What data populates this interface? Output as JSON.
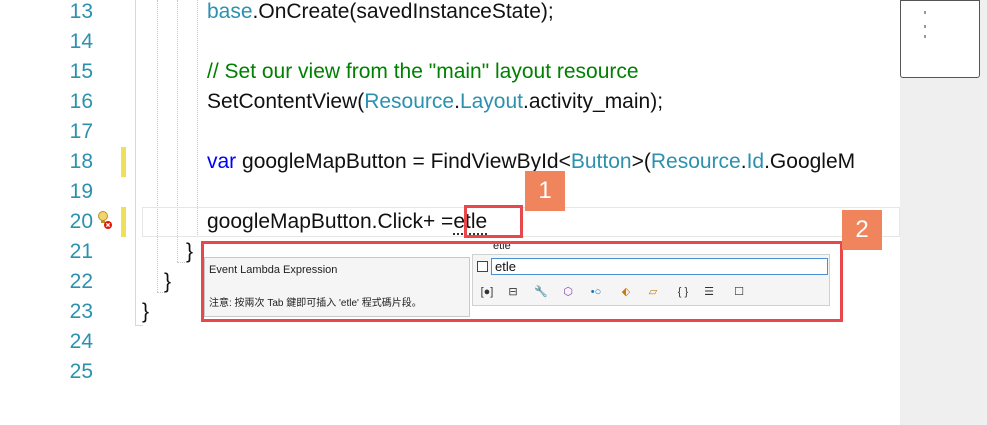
{
  "editor": {
    "line_numbers": [
      "13",
      "14",
      "15",
      "16",
      "17",
      "18",
      "19",
      "20",
      "21",
      "22",
      "23",
      "24",
      "25"
    ],
    "lines": {
      "l13": {
        "a": "base",
        "b": ".OnCreate(savedInstanceState);"
      },
      "l15": {
        "comment": "// Set our view from the \"main\" layout resource"
      },
      "l16": {
        "a": "SetContentView(",
        "b": "Resource",
        "c": ".",
        "d": "Layout",
        "e": ".activity_main);"
      },
      "l18": {
        "a": "var",
        "b": " googleMapButton = FindViewById<",
        "c": "Button",
        "d": ">(",
        "e": "Resource",
        "f": ".",
        "g": "Id",
        "h": ".GoogleM"
      },
      "l20": {
        "a": "googleMapButton.Click+ =",
        "b": "etle"
      },
      "l21": {
        "brace": "}"
      },
      "l22": {
        "brace": "}"
      },
      "l23": {
        "brace": "}"
      }
    }
  },
  "callouts": {
    "one": "1",
    "two": "2"
  },
  "completion": {
    "title": "Event Lambda Expression",
    "hint": "注意: 按兩次 Tab 鍵即可插入 'etle' 程式碼片段。",
    "snippet_label": "etle",
    "snippet_value": "etle",
    "filters": [
      {
        "name": "field-filter-icon",
        "glyph": "[●]"
      },
      {
        "name": "property-filter-icon",
        "glyph": "⊟"
      },
      {
        "name": "wrench-filter-icon",
        "glyph": "🔧"
      },
      {
        "name": "class-filter-icon",
        "glyph": "⬡"
      },
      {
        "name": "interface-filter-icon",
        "glyph": "•○"
      },
      {
        "name": "struct-filter-icon",
        "glyph": "⬖"
      },
      {
        "name": "enum-filter-icon",
        "glyph": "▱"
      },
      {
        "name": "namespace-filter-icon",
        "glyph": "{ }"
      },
      {
        "name": "keyword-filter-icon",
        "glyph": "☰"
      },
      {
        "name": "snippet-filter-icon",
        "glyph": "☐"
      }
    ]
  },
  "colors": {
    "accent_callout": "#e8474c",
    "callout_badge": "#f0845c",
    "keyword": "#0000ff",
    "type": "#2b91af",
    "comment": "#008000"
  }
}
